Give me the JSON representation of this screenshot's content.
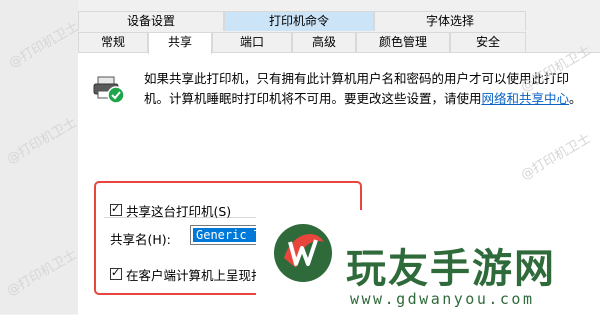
{
  "tabs_row1": [
    "设备设置",
    "打印机命令",
    "字体选择"
  ],
  "tabs_row2": [
    "常规",
    "共享",
    "端口",
    "高级",
    "颜色管理",
    "安全"
  ],
  "description": {
    "text": "如果共享此打印机，只有拥有此计算机用户名和密码的用户才可以使用此打印机。计算机睡眠时打印机将不可用。要更改这些设置，请使用",
    "link": "网络和共享中心",
    "suffix": "。"
  },
  "share_checkbox_label": "共享这台打印机(S)",
  "share_name_label": "共享名(H):",
  "share_name_value": "Generic Te",
  "render_checkbox_label": "在客户端计算机上呈现打",
  "watermark_text": "@打印机卫士",
  "brand": {
    "name": "玩友手游网",
    "url": "www.gdwanyou.com"
  },
  "colors": {
    "accent": "#0078d7",
    "highlight_box": "#e8453c",
    "brand_green": "#2f6a3a"
  }
}
